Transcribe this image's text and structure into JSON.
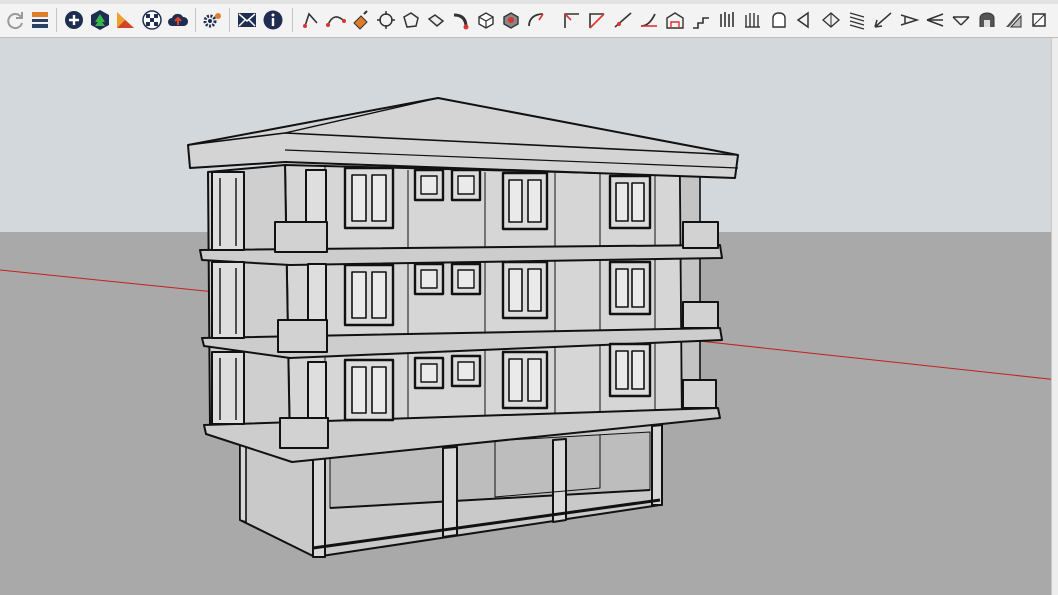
{
  "toolbar": {
    "tools": [
      {
        "id": "refresh",
        "icon": "refresh-icon"
      },
      {
        "id": "model-info",
        "icon": "layers-icon"
      },
      {
        "id": "add-location",
        "icon": "add-location-icon"
      },
      {
        "id": "toggle-terrain",
        "icon": "terrain-icon"
      },
      {
        "id": "sandbox",
        "icon": "sandbox-icon"
      },
      {
        "id": "materials",
        "icon": "checker-icon"
      },
      {
        "id": "share-model",
        "icon": "cloud-upload-icon"
      },
      {
        "id": "extensions",
        "icon": "gears-icon"
      },
      {
        "id": "send-message",
        "icon": "mail-icon"
      },
      {
        "id": "model-info-2",
        "icon": "info-icon"
      },
      {
        "id": "t1",
        "icon": "edge-tool-icon"
      },
      {
        "id": "t2",
        "icon": "curve-tool-icon"
      },
      {
        "id": "t3",
        "icon": "paint-tool-icon"
      },
      {
        "id": "t4",
        "icon": "gear-shape-icon"
      },
      {
        "id": "t5",
        "icon": "outline-shape-icon"
      },
      {
        "id": "t6",
        "icon": "bend-tool-icon"
      },
      {
        "id": "t7",
        "icon": "box-tool-icon"
      },
      {
        "id": "t8",
        "icon": "solid-tool-icon"
      },
      {
        "id": "t9",
        "icon": "pipe-tool-icon"
      },
      {
        "id": "t10",
        "icon": "corner-tool-icon"
      },
      {
        "id": "t11",
        "icon": "corner-alt-icon"
      },
      {
        "id": "t12",
        "icon": "arrow-line-icon"
      },
      {
        "id": "t13",
        "icon": "arc-tool-icon"
      },
      {
        "id": "t14",
        "icon": "profile-tool-icon"
      },
      {
        "id": "t15",
        "icon": "roof-tool-icon"
      },
      {
        "id": "t16",
        "icon": "stairs-tool-icon"
      },
      {
        "id": "t17",
        "icon": "columns-tool-icon"
      },
      {
        "id": "t18",
        "icon": "grab-tool-icon"
      },
      {
        "id": "t19",
        "icon": "face-tool-icon"
      },
      {
        "id": "t20",
        "icon": "split-tool-icon"
      },
      {
        "id": "t21",
        "icon": "ribbon-tool-icon"
      },
      {
        "id": "t22",
        "icon": "ramp-tool-icon"
      },
      {
        "id": "t23",
        "icon": "wing-tool-icon"
      },
      {
        "id": "t24",
        "icon": "stitch-tool-icon"
      },
      {
        "id": "t25",
        "icon": "fan-tool-icon"
      },
      {
        "id": "t26",
        "icon": "arch-tool-icon"
      },
      {
        "id": "t27",
        "icon": "hatch-tool-icon"
      },
      {
        "id": "t28",
        "icon": "window-tool-icon"
      }
    ]
  }
}
